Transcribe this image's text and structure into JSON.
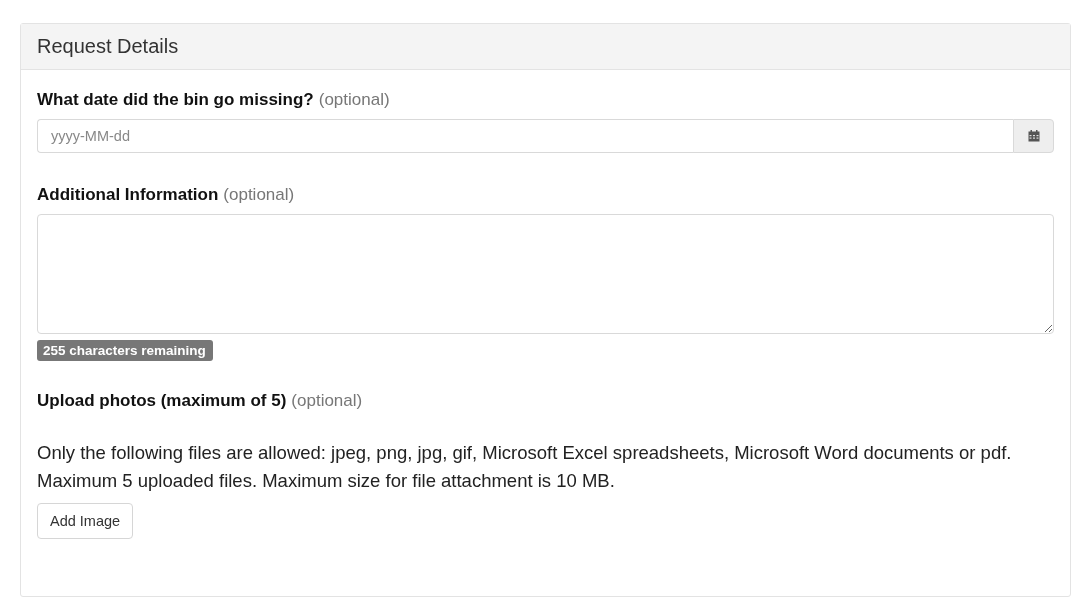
{
  "panel": {
    "title": "Request Details"
  },
  "fields": [
    {
      "kind": "date",
      "label": "What date did the bin go missing?",
      "hint": "(optional)",
      "placeholder": "yyyy-MM-dd"
    },
    {
      "kind": "textarea",
      "label": "Additional Information",
      "hint": "(optional)",
      "counter": "255 characters remaining"
    },
    {
      "kind": "upload",
      "label": "Upload photos (maximum of 5)",
      "hint": "(optional)",
      "description": "Only the following files are allowed: jpeg, png, jpg, gif, Microsoft Excel spreadsheets, Microsoft Word documents or pdf. Maximum 5 uploaded files. Maximum size for file attachment is 10 MB.",
      "button": "Add Image"
    }
  ]
}
